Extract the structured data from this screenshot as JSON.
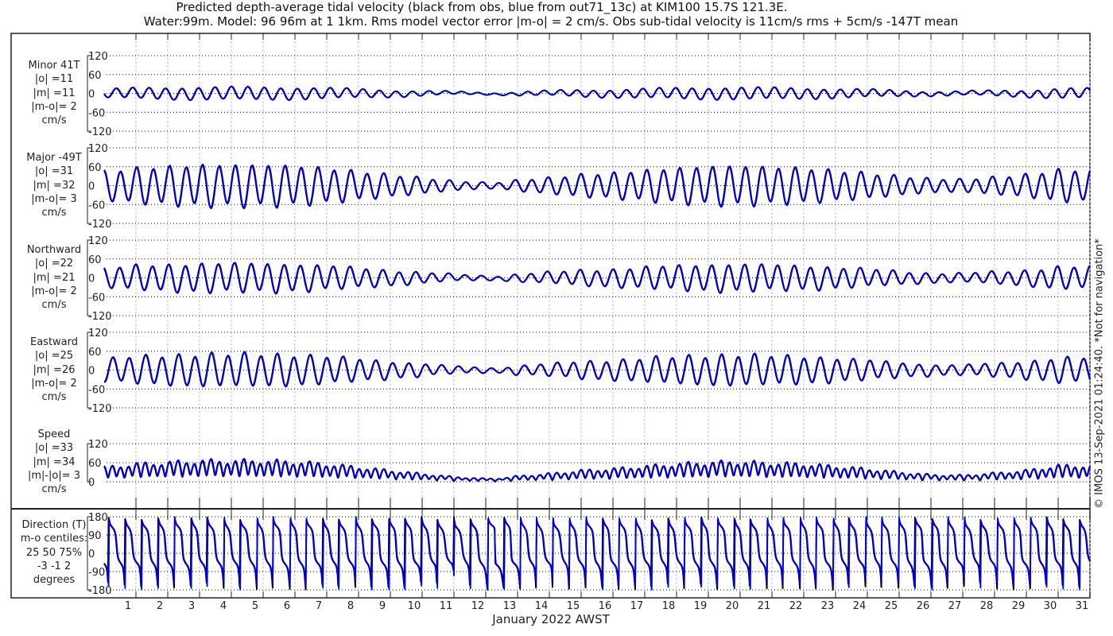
{
  "header": {
    "title_line1": "Predicted depth-average tidal velocity (black from obs, blue from out71_13c) at KIM100 15.7S 121.3E.",
    "title_line2": "Water:99m. Model: 96 96m at 1 1km. Rms model vector error |m-o| = 2 cm/s. Obs sub-tidal velocity is 11cm/s rms + 5cm/s -147T mean"
  },
  "copyright": "© IMOS 13-Sep-2021 01:24:40. *Not for navigation*",
  "colors": {
    "model": "#0000ee",
    "obs": "#000000",
    "grid": "#000000",
    "day_grid": "#b8c4e0"
  },
  "chart_data": {
    "type": "line",
    "xlabel": "January 2022 AWST",
    "xticks": [
      "1",
      "2",
      "3",
      "4",
      "5",
      "6",
      "7",
      "8",
      "9",
      "10",
      "11",
      "12",
      "13",
      "14",
      "15",
      "16",
      "17",
      "18",
      "19",
      "20",
      "21",
      "22",
      "23",
      "24",
      "25",
      "26",
      "27",
      "28",
      "29",
      "30",
      "31"
    ],
    "xlim_days": [
      -0.5,
      31
    ],
    "tidal_period_days": 0.5175,
    "major_axis_deg": -49,
    "minor_axis_deg": 41,
    "major_envelope": {
      "day": [
        0,
        1,
        2,
        3,
        4,
        5,
        6,
        7,
        8,
        9,
        10,
        11,
        12,
        12.5,
        13,
        14,
        15,
        16,
        17,
        18,
        19,
        20,
        21,
        22,
        23,
        24,
        25,
        26,
        27,
        28,
        29,
        30,
        31
      ],
      "amp": [
        45,
        55,
        60,
        65,
        65,
        65,
        62,
        55,
        45,
        35,
        25,
        15,
        10,
        10,
        18,
        25,
        35,
        40,
        48,
        55,
        60,
        62,
        58,
        55,
        48,
        40,
        30,
        22,
        20,
        27,
        35,
        50,
        50
      ]
    },
    "minor_ratio": 0.3,
    "panels": [
      {
        "id": "minor",
        "label": [
          "Minor 41T",
          "|o| =11",
          "|m| =11",
          "|m-o|= 2",
          "cm/s"
        ],
        "yticks": [
          "120",
          "60",
          "0",
          "-60",
          "-120"
        ],
        "ylim": [
          -120,
          120
        ]
      },
      {
        "id": "major",
        "label": [
          "Major -49T",
          "|o| =31",
          "|m| =32",
          "|m-o|= 3",
          "cm/s"
        ],
        "yticks": [
          "120",
          "60",
          "0",
          "-60",
          "-120"
        ],
        "ylim": [
          -120,
          120
        ]
      },
      {
        "id": "north",
        "label": [
          "Northward",
          "|o| =22",
          "|m| =21",
          "|m-o|= 2",
          "cm/s"
        ],
        "yticks": [
          "120",
          "60",
          "0",
          "-60",
          "-120"
        ],
        "ylim": [
          -120,
          120
        ]
      },
      {
        "id": "east",
        "label": [
          "Eastward",
          "|o| =25",
          "|m| =26",
          "|m-o|= 2",
          "cm/s"
        ],
        "yticks": [
          "120",
          "60",
          "0",
          "-60",
          "-120"
        ],
        "ylim": [
          -120,
          120
        ]
      },
      {
        "id": "speed",
        "label": [
          "Speed",
          "|o| =33",
          "|m| =34",
          "|m|-|o|= 3",
          "cm/s"
        ],
        "yticks": [
          "120",
          "60",
          "0"
        ],
        "ylim": [
          0,
          120
        ]
      },
      {
        "id": "direction",
        "label": [
          "Direction (T)",
          "m-o centiles:",
          "25  50  75%",
          "-3 -1  2",
          "degrees"
        ],
        "yticks": [
          "180",
          "90",
          "0",
          "-90",
          "-180"
        ],
        "ylim": [
          -180,
          180
        ]
      }
    ]
  }
}
